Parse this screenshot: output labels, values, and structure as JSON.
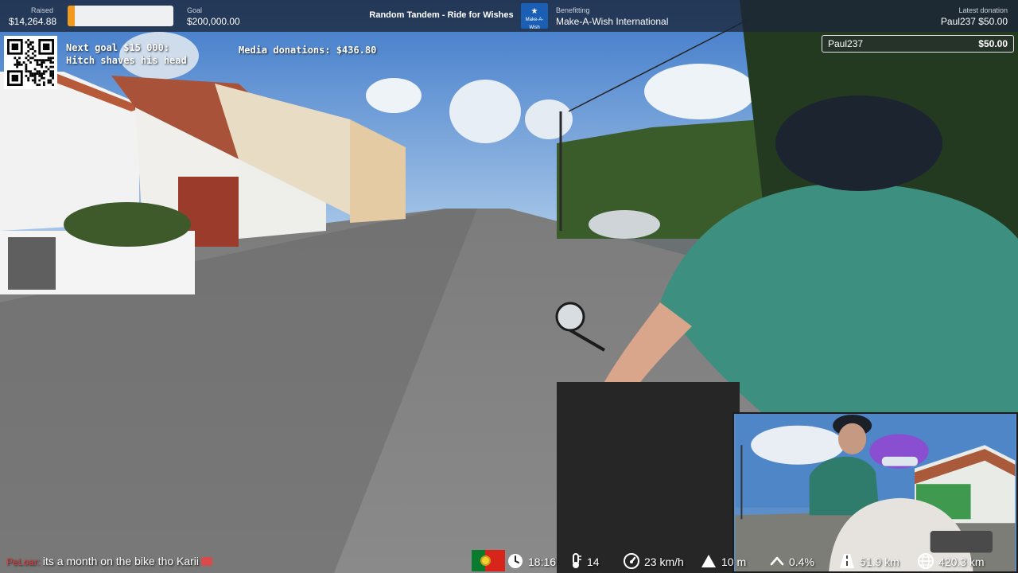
{
  "topbar": {
    "raised_label": "Raised",
    "raised_value": "$14,264.88",
    "goal_label": "Goal",
    "goal_value": "$200,000.00",
    "progress_fraction": 0.0713,
    "title": "Random Tandem - Ride for Wishes",
    "charity_logo_text": "Make-A-Wish",
    "benefitting_label": "Benefitting",
    "benefitting_value": "Make-A-Wish International",
    "latest_label": "Latest donation",
    "latest_value": "Paul237 $50.00"
  },
  "overlay": {
    "next_goal": "Next goal $15 000: Hitch shaves his head",
    "media_donations": "Media donations: $436.80"
  },
  "donation_alert": {
    "name": "Paul237",
    "amount": "$50.00"
  },
  "chat": {
    "user": "PeLoar:",
    "message": "its a month on the bike tho Karii"
  },
  "stats": {
    "time": "18:16",
    "temperature": "14",
    "speed": "23 km/h",
    "altitude": "10 m",
    "incline": "0.4%",
    "distance_today": "51.9 km",
    "distance_total": "420.3 km"
  },
  "icons": {
    "flag": "portugal-flag-icon",
    "time": "clock-icon",
    "temperature": "thermometer-icon",
    "speed": "speedometer-icon",
    "altitude": "mountain-icon",
    "incline": "chevron-up-icon",
    "distance_today": "road-icon",
    "distance_total": "globe-icon"
  },
  "colors": {
    "progress": "#f29a1e",
    "topbar": "#1c2638",
    "chat_user": "#e23b3b",
    "maw_blue": "#1a5fb4"
  }
}
